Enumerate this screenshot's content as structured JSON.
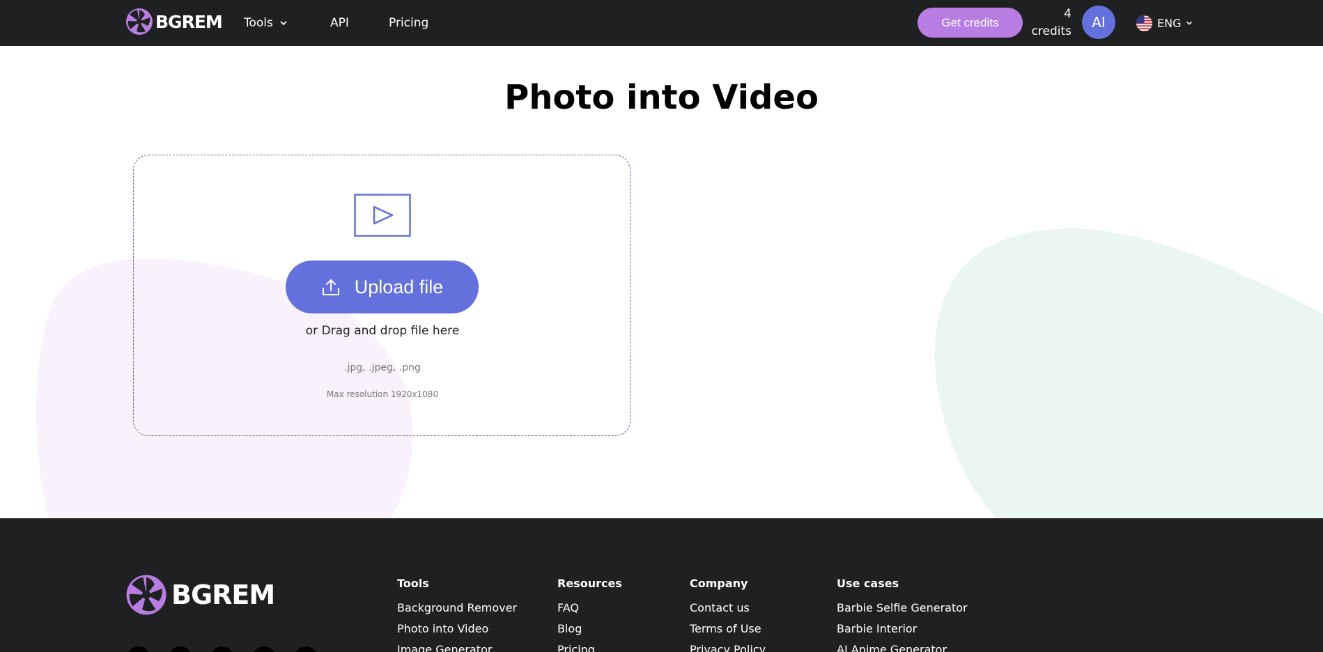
{
  "header": {
    "logo_text": "BGREM",
    "nav": {
      "tools": "Tools",
      "api": "API",
      "pricing": "Pricing"
    },
    "get_credits": "Get credits",
    "credits_count": "4",
    "credits_label": "credits",
    "avatar_initials": "AI",
    "language": "ENG"
  },
  "main": {
    "title": "Photo into Video",
    "upload_button": "Upload file",
    "drag_text": "or Drag and drop file here",
    "formats": ".jpg, .jpeg, .png",
    "max_resolution": "Max resolution 1920x1080"
  },
  "footer": {
    "logo_text": "BGREM",
    "columns": [
      {
        "heading": "Tools",
        "items": [
          "Background Remover",
          "Photo into Video",
          "Image Generator"
        ]
      },
      {
        "heading": "Resources",
        "items": [
          "FAQ",
          "Blog",
          "Pricing"
        ]
      },
      {
        "heading": "Company",
        "items": [
          "Contact us",
          "Terms of Use",
          "Privacy Policy"
        ]
      },
      {
        "heading": "Use cases",
        "items": [
          "Barbie Selfie Generator",
          "Barbie Interior",
          "AI Anime Generator"
        ]
      }
    ]
  },
  "colors": {
    "header_bg": "#1f2021",
    "accent_purple": "#b87de3",
    "primary_blue": "#6470dc",
    "blob_pink": "#f9f1fc",
    "blob_mint": "#e9f6f2"
  }
}
